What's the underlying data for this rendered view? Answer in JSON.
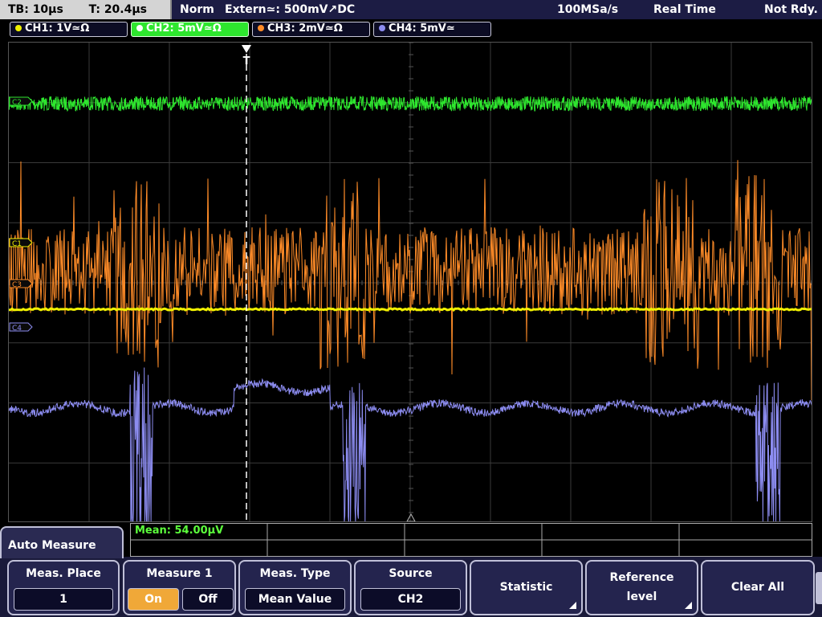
{
  "status_bar": {
    "timebase": "TB: 10µs",
    "trigger_time": "T: 20.4µs",
    "trigger_mode": "Norm",
    "trigger_source": "Extern≃: 500mV↗DC",
    "sample_rate": "100MSa/s",
    "acq_mode": "Real Time",
    "trigger_status": "Not Rdy."
  },
  "channels": [
    {
      "label": "CH1: 1V≃Ω",
      "color": "#f0f000",
      "active": false
    },
    {
      "label": "CH2: 5mV≃Ω",
      "color": "#2ee62e",
      "active": true
    },
    {
      "label": "CH3: 2mV≃Ω",
      "color": "#ff8c28",
      "active": false
    },
    {
      "label": "CH4: 5mV≃",
      "color": "#8c8cf0",
      "active": false
    }
  ],
  "markers": {
    "c2": "C2",
    "c1": "C1",
    "c3": "C3",
    "c4": "C4",
    "trigger": "T"
  },
  "measurement": {
    "result": "Mean: 54.00µV"
  },
  "menu": {
    "title": "Auto Measure",
    "meas_place": {
      "label": "Meas. Place",
      "value": "1"
    },
    "measure1": {
      "label": "Measure 1",
      "on": "On",
      "off": "Off",
      "state": "On"
    },
    "meas_type": {
      "label": "Meas. Type",
      "value": "Mean Value"
    },
    "source": {
      "label": "Source",
      "value": "CH2"
    },
    "statistic": {
      "label": "Statistic"
    },
    "reference_level": {
      "label_line1": "Reference",
      "label_line2": "level"
    },
    "clear_all": {
      "label": "Clear All"
    }
  },
  "colors": {
    "ch1": "#f0f000",
    "ch2": "#2ee62e",
    "ch3": "#ff8c28",
    "ch4": "#8c8cf0",
    "grid": "#3a3a3a",
    "on_button": "#f0a838"
  }
}
